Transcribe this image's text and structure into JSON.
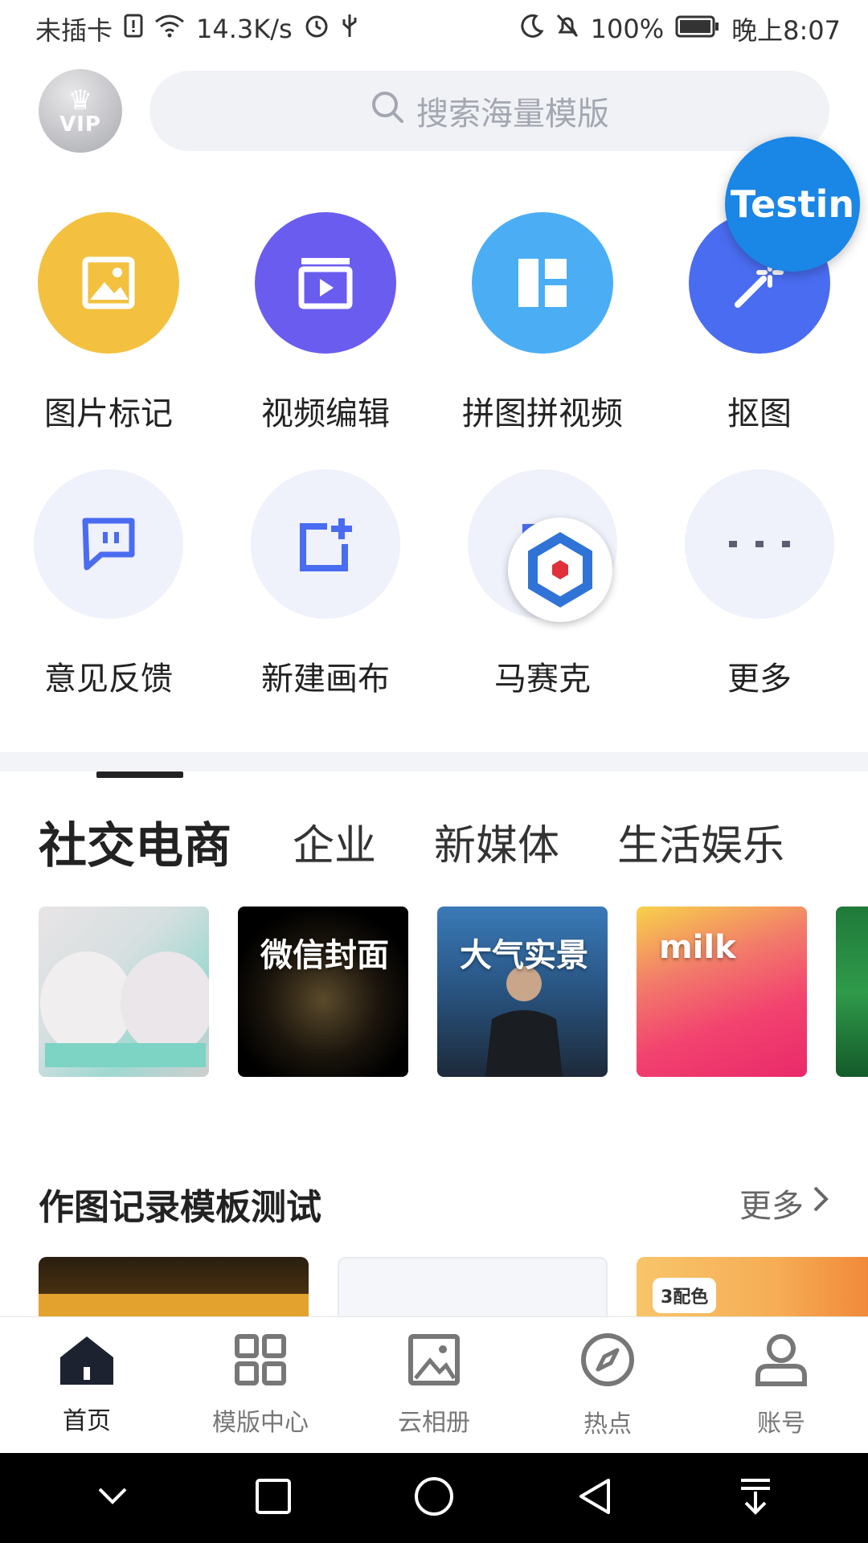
{
  "status_bar": {
    "carrier": "未插卡",
    "speed": "14.3K/s",
    "battery": "100%",
    "time": "晚上8:07"
  },
  "header": {
    "vip_label": "VIP",
    "search_placeholder": "搜索海量模版"
  },
  "overlay": {
    "testin_label": "Testin"
  },
  "tools_row1": [
    {
      "label": "图片标记",
      "icon": "image-icon",
      "color": "#F3C13F"
    },
    {
      "label": "视频编辑",
      "icon": "video-play-icon",
      "color": "#6B5CF0"
    },
    {
      "label": "拼图拼视频",
      "icon": "collage-layout-icon",
      "color": "#4BAEF5"
    },
    {
      "label": "抠图",
      "icon": "magic-wand-icon",
      "color": "#4A6CF0"
    }
  ],
  "tools_row2": [
    {
      "label": "意见反馈",
      "icon": "feedback-chat-icon"
    },
    {
      "label": "新建画布",
      "icon": "new-canvas-icon"
    },
    {
      "label": "马赛克",
      "icon": "mosaic-icon"
    },
    {
      "label": "更多",
      "icon": "more-dots-icon"
    }
  ],
  "categories": {
    "active": "社交电商",
    "items": [
      "企业",
      "新媒体",
      "生活娱乐"
    ]
  },
  "templates": [
    {
      "caption": ""
    },
    {
      "caption": "微信封面"
    },
    {
      "caption": "大气实景"
    },
    {
      "caption": "milk"
    },
    {
      "caption": ""
    }
  ],
  "section": {
    "title": "作图记录模板测试",
    "more": "更多"
  },
  "records": [
    {
      "badge": ""
    },
    {
      "badge": ""
    },
    {
      "badge": "3配色"
    }
  ],
  "bottom_nav": [
    {
      "label": "首页",
      "icon": "home-icon",
      "active": true
    },
    {
      "label": "模版中心",
      "icon": "grid-icon",
      "active": false
    },
    {
      "label": "云相册",
      "icon": "album-icon",
      "active": false
    },
    {
      "label": "热点",
      "icon": "compass-icon",
      "active": false
    },
    {
      "label": "账号",
      "icon": "user-icon",
      "active": false
    }
  ],
  "colors": {
    "accent_blue": "#4A6CF0",
    "testin_blue": "#1A86E6",
    "text_dark": "#222222"
  }
}
